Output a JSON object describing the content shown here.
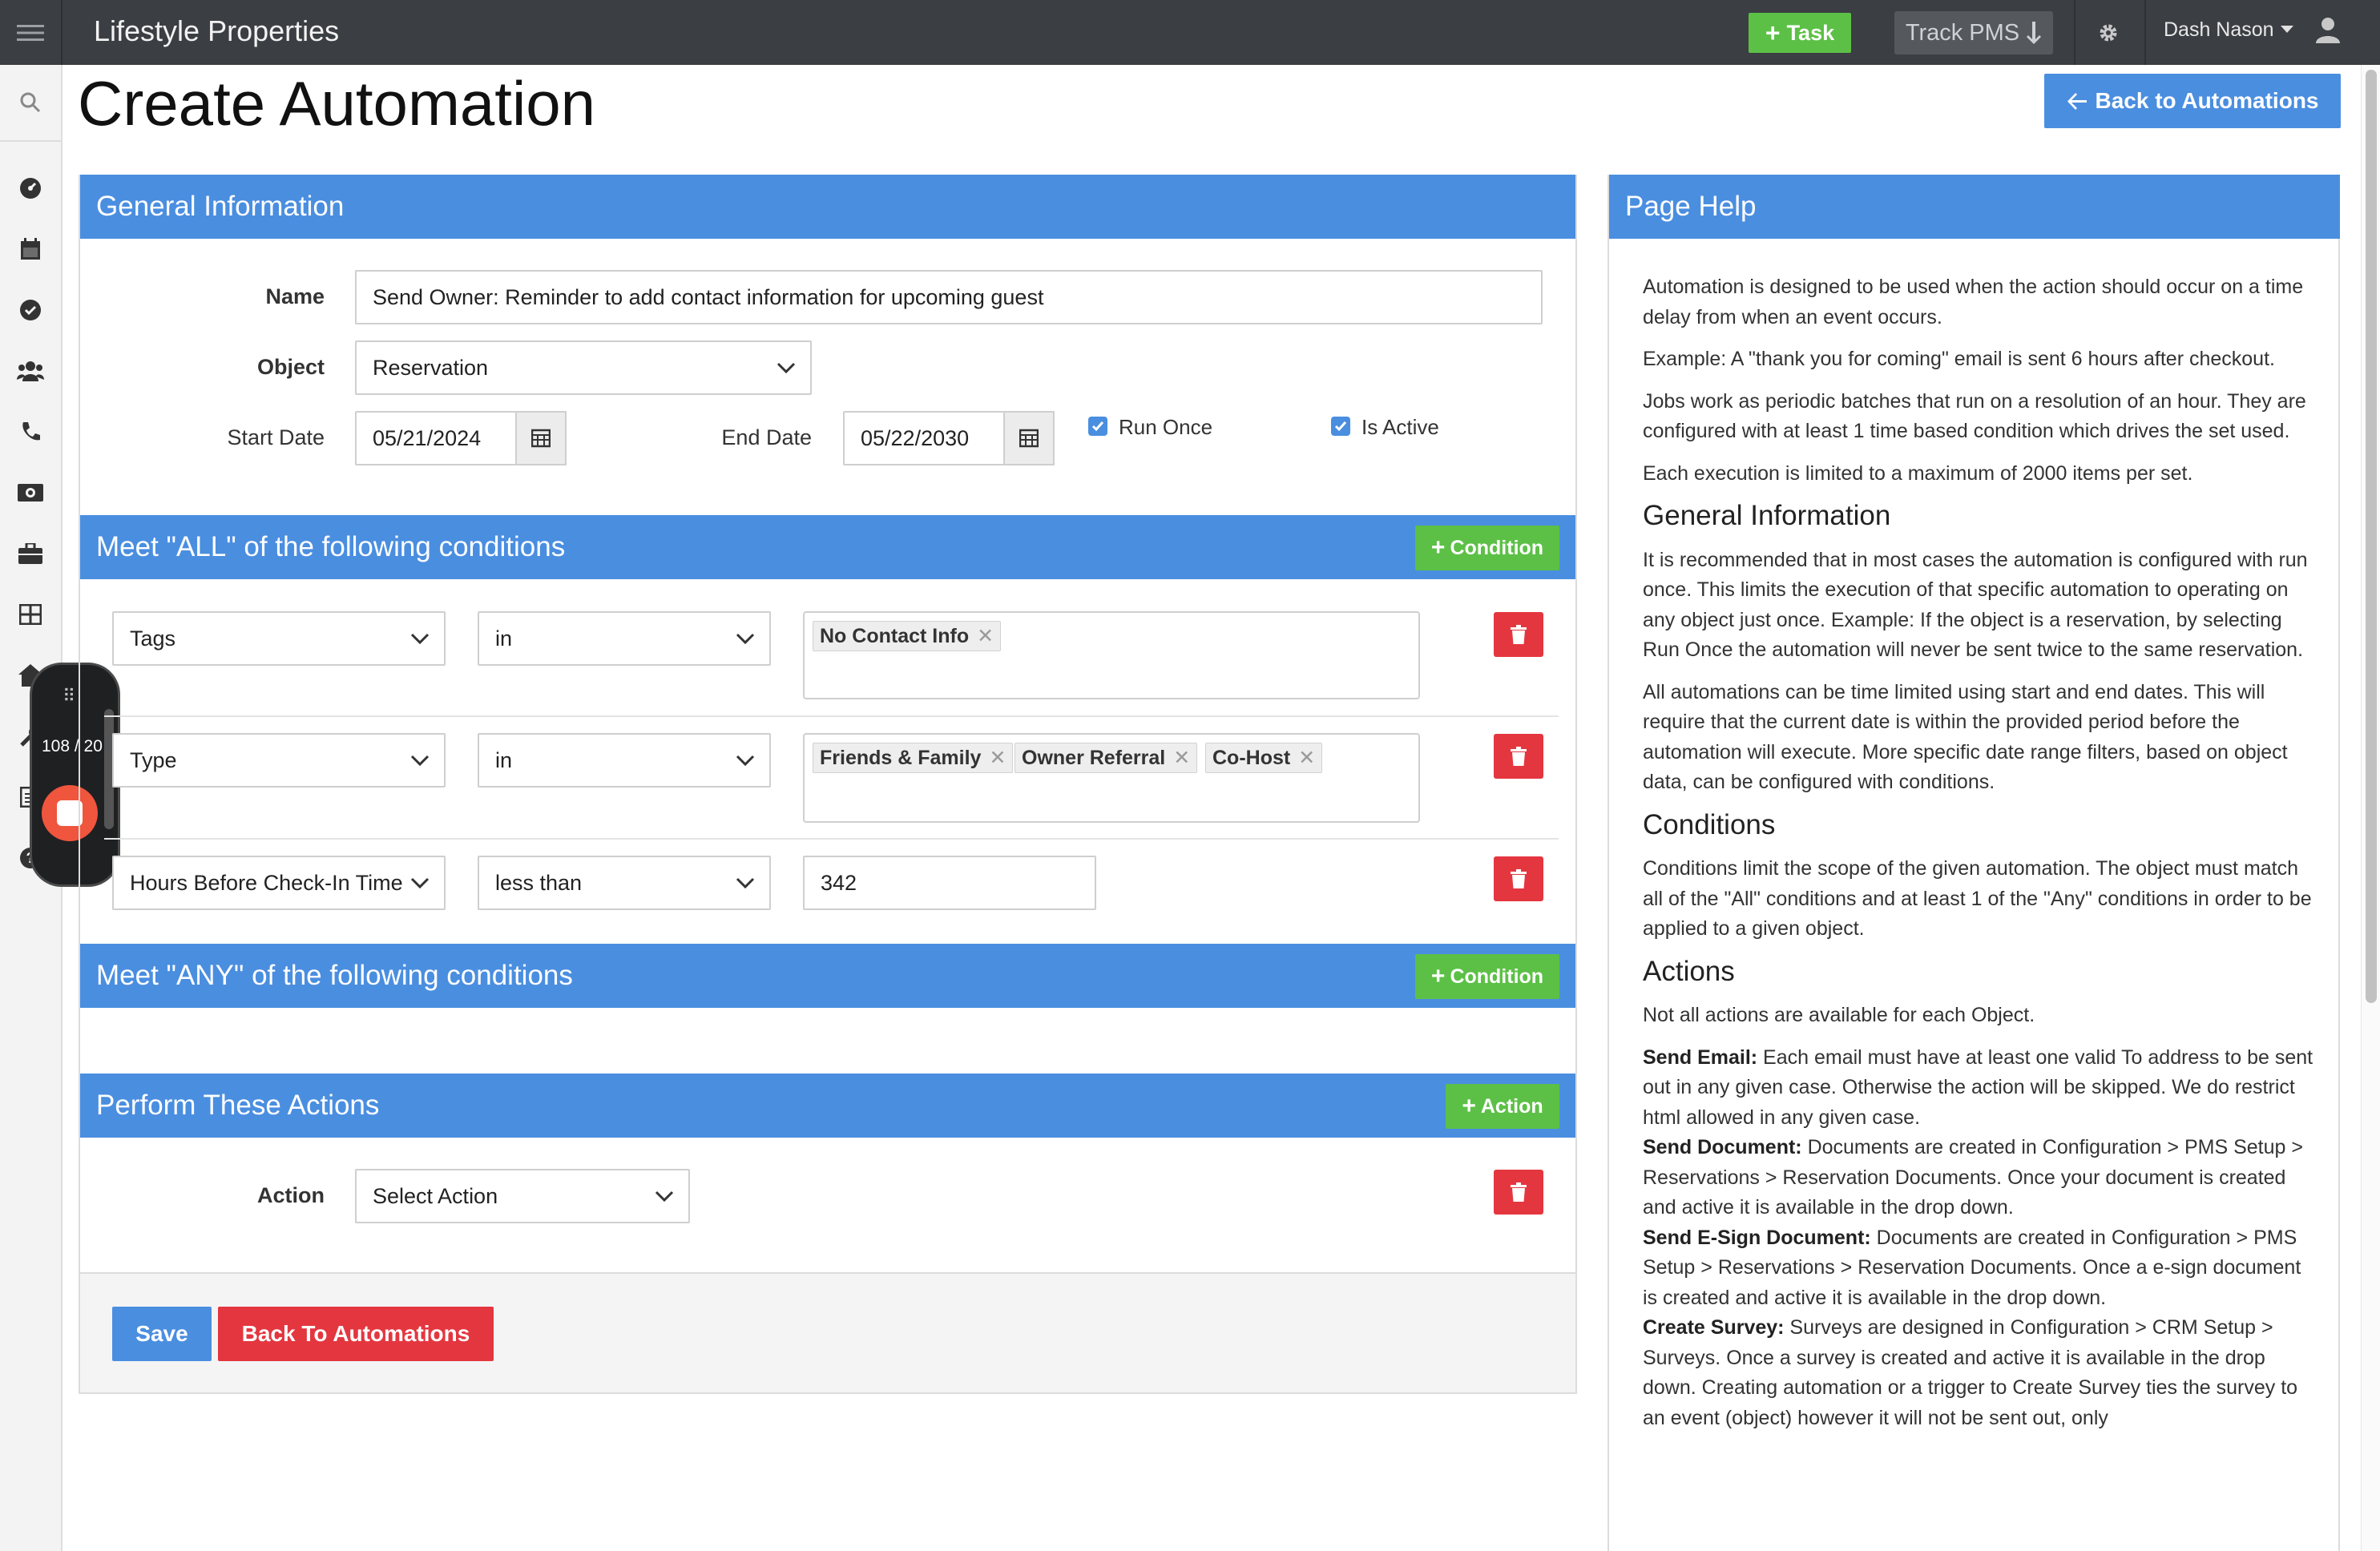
{
  "app": {
    "brand": "Lifestyle Properties",
    "task_label": "Task",
    "track_label": "Track PMS",
    "user_name": "Dash Nason"
  },
  "page": {
    "title": "Create Automation",
    "back_top_label": "Back to Automations"
  },
  "general": {
    "header": "General Information",
    "name_label": "Name",
    "name_value": "Send Owner: Reminder to add contact information for upcoming guest",
    "object_label": "Object",
    "object_value": "Reservation",
    "start_label": "Start Date",
    "start_value": "05/21/2024",
    "end_label": "End Date",
    "end_value": "05/22/2030",
    "run_once_label": "Run Once",
    "is_active_label": "Is Active"
  },
  "all_conditions": {
    "header": "Meet \"ALL\" of the following conditions",
    "add_label": "Condition",
    "rows": [
      {
        "field": "Tags",
        "operator": "in",
        "tags": [
          "No Contact Info"
        ]
      },
      {
        "field": "Type",
        "operator": "in",
        "tags": [
          "Friends & Family",
          "Owner Referral",
          "Co-Host"
        ]
      },
      {
        "field": "Hours Before Check-In Time",
        "operator": "less than",
        "value": "342"
      }
    ]
  },
  "any_conditions": {
    "header": "Meet \"ANY\" of the following conditions",
    "add_label": "Condition"
  },
  "actions": {
    "header": "Perform These Actions",
    "add_label": "Action",
    "action_label": "Action",
    "action_value": "Select Action"
  },
  "footer": {
    "save_label": "Save",
    "back_label": "Back To Automations"
  },
  "recorder": {
    "count": "108 / 20"
  },
  "help": {
    "header": "Page Help",
    "p1": "Automation is designed to be used when the action should occur on a time delay from when an event occurs.",
    "p2": "Example: A \"thank you for coming\" email is sent 6 hours after checkout.",
    "p3": "Jobs work as periodic batches that run on a resolution of an hour. They are configured with at least 1 time based condition which drives the set used.",
    "p4": "Each execution is limited to a maximum of 2000 items per set.",
    "h_general": "General Information",
    "p5": "It is recommended that in most cases the automation is configured with run once. This limits the execution of that specific automation to operating on any object just once. Example: If the object is a reservation, by selecting Run Once the automation will never be sent twice to the same reservation.",
    "p6": "All automations can be time limited using start and end dates. This will require that the current date is within the provided period before the automation will execute. More specific date range filters, based on object data, can be configured with conditions.",
    "h_conditions": "Conditions",
    "p7": "Conditions limit the scope of the given automation. The object must match all of the \"All\" conditions and at least 1 of the \"Any\" conditions in order to be applied to a given object.",
    "h_actions": "Actions",
    "p8": "Not all actions are available for each Object.",
    "send_email_title": "Send Email:",
    "send_email_text": " Each email must have at least one valid To address to be sent out in any given case. Otherwise the action will be skipped. We do restrict html allowed in any given case.",
    "send_doc_title": "Send Document:",
    "send_doc_text": " Documents are created in Configuration > PMS Setup > Reservations > Reservation Documents. Once your document is created and active it is available in the drop down.",
    "send_esign_title": "Send E-Sign Document:",
    "send_esign_text": " Documents are created in Configuration > PMS Setup > Reservations > Reservation Documents. Once a e-sign document is created and active it is available in the drop down.",
    "survey_title": "Create Survey:",
    "survey_text": " Surveys are designed in Configuration > CRM Setup > Surveys. Once a survey is created and active it is available in the drop down. Creating automation or a trigger to Create Survey ties the survey to an event (object) however it will not be sent out, only"
  },
  "colors": {
    "primary": "#4a8ee0",
    "success": "#5cc046",
    "danger": "#e4363f",
    "topbar": "#3b3e42"
  }
}
